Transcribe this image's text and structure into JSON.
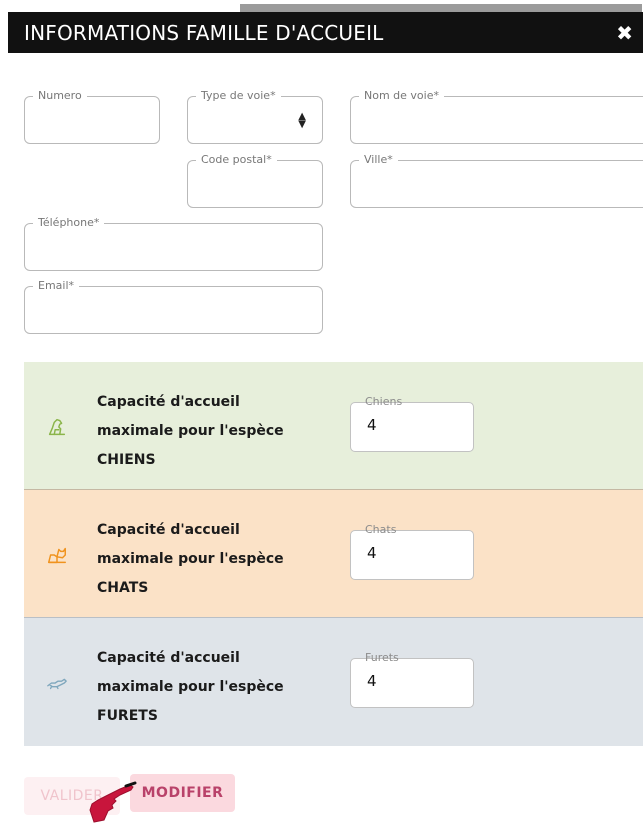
{
  "dialog": {
    "title": "INFORMATIONS FAMILLE D'ACCUEIL",
    "close_symbol": "✖"
  },
  "form": {
    "numero": {
      "label": "Numero",
      "value": ""
    },
    "type_de_voie": {
      "label": "Type de voie*",
      "value": ""
    },
    "nom_de_voie": {
      "label": "Nom de voie*",
      "value": ""
    },
    "code_postal": {
      "label": "Code postal*",
      "value": ""
    },
    "ville": {
      "label": "Ville*",
      "value": ""
    },
    "telephone": {
      "label": "Téléphone*",
      "value": ""
    },
    "email": {
      "label": "Email*",
      "value": ""
    }
  },
  "capacity": [
    {
      "line1": "Capacité d'accueil",
      "line2": "maximale pour l'espèce",
      "species": "CHIENS",
      "field_label": "Chiens",
      "value": "4",
      "icon": "dog-icon",
      "icon_color": "#8bb54a",
      "bg": "#e7efdb"
    },
    {
      "line1": "Capacité d'accueil",
      "line2": "maximale pour l'espèce",
      "species": "CHATS",
      "field_label": "Chats",
      "value": "4",
      "icon": "cat-icon",
      "icon_color": "#f0931e",
      "bg": "#fbe2c7"
    },
    {
      "line1": "Capacité d'accueil",
      "line2": "maximale pour l'espèce",
      "species": "FURETS",
      "field_label": "Furets",
      "value": "4",
      "icon": "ferret-icon",
      "icon_color": "#7fa7bd",
      "bg": "#dfe4e9"
    }
  ],
  "actions": {
    "valider": "VALIDER",
    "modifier": "MODIFIER"
  },
  "colors": {
    "header_bg": "#111111",
    "accent": "#b9426a"
  }
}
